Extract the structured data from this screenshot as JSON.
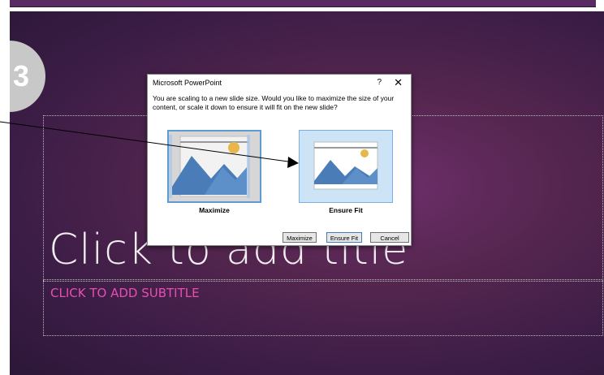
{
  "step": {
    "number": "3"
  },
  "slide": {
    "title_placeholder": "Click to add title",
    "subtitle_placeholder": "CLICK TO ADD SUBTITLE"
  },
  "dialog": {
    "title": "Microsoft PowerPoint",
    "help_label": "?",
    "close_label": "✕",
    "message": "You are scaling to a new slide size.  Would you like to maximize the size of your content, or scale it down to ensure it will fit on the new slide?",
    "options": [
      {
        "label": "Maximize"
      },
      {
        "label": "Ensure Fit"
      }
    ],
    "buttons": {
      "maximize": "Maximize",
      "ensure_fit": "Ensure Fit",
      "cancel": "Cancel"
    }
  },
  "colors": {
    "subtitle": "#e64fb1",
    "selection_border": "#5f9bd1",
    "mountain": "#4a7db8",
    "sun": "#e9b64c"
  }
}
